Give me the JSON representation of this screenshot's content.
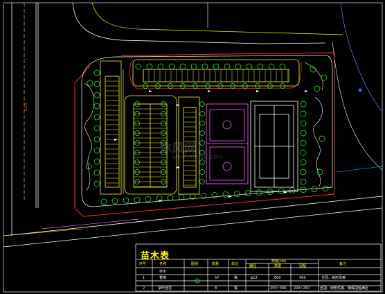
{
  "drawing": {
    "side_label": "8.5%",
    "watermark_main": "沐风网",
    "watermark_sub": "www.mfcad.com"
  },
  "table": {
    "title": "苗木表",
    "headers": [
      "序号",
      "名称",
      "图例",
      "数量",
      "单位",
      "规格",
      "备注"
    ],
    "sub_header": "规格(cm)",
    "spec_subheaders": [
      "胸径",
      "高度",
      "冠幅"
    ],
    "rows": [
      {
        "no": "",
        "name": "乔木",
        "qty": "",
        "unit": "",
        "diameter": "",
        "height": "",
        "crown": "",
        "note": ""
      },
      {
        "no": "1",
        "name": "香樟",
        "qty": "57",
        "unit": "株",
        "diameter": "φ12",
        "height": "600",
        "crown": "450",
        "note": "全冠、树形优美"
      },
      {
        "no": "2",
        "name": "杂叶桂花",
        "qty": "8",
        "unit": "株",
        "diameter": "",
        "height": "250~300",
        "crown": "220~250",
        "note": "全冠、树形优美、确保冠幅满足"
      }
    ]
  },
  "colors": {
    "background": "#000000",
    "parking_outline": "#ffff00",
    "road_edge": "#ffffff",
    "site_boundary": "#ff3030",
    "trees": "#33ff33",
    "sports_courts": "#ff66ff",
    "table_grid": "#ffffff"
  }
}
